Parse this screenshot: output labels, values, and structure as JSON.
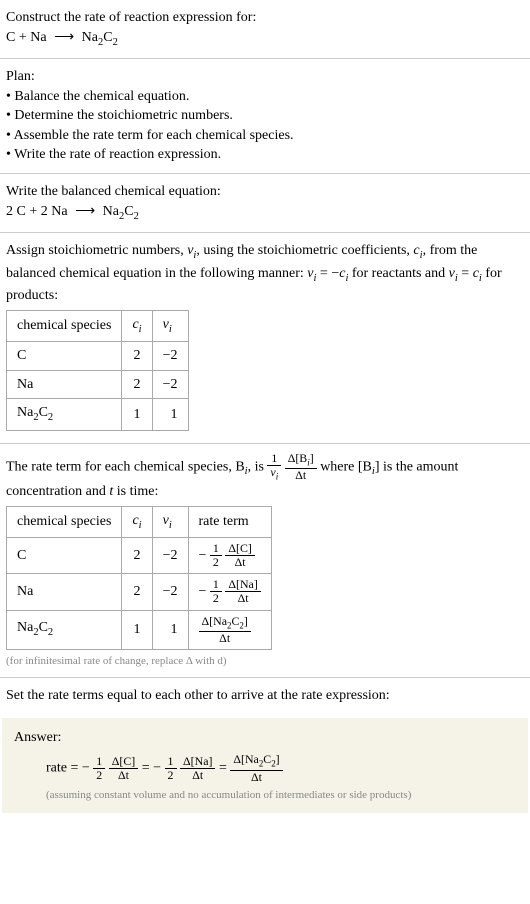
{
  "header": {
    "prompt": "Construct the rate of reaction expression for:",
    "equation_lhs_1": "C",
    "equation_plus": " + ",
    "equation_lhs_2": "Na",
    "equation_arrow": "⟶",
    "equation_rhs": "Na",
    "equation_rhs_sub1": "2",
    "equation_rhs_2": "C",
    "equation_rhs_sub2": "2"
  },
  "plan": {
    "title": "Plan:",
    "items": [
      "Balance the chemical equation.",
      "Determine the stoichiometric numbers.",
      "Assemble the rate term for each chemical species.",
      "Write the rate of reaction expression."
    ]
  },
  "balanced": {
    "title": "Write the balanced chemical equation:",
    "coef1": "2 ",
    "sp1": "C",
    "plus": " + ",
    "coef2": "2 ",
    "sp2": "Na",
    "arrow": "⟶",
    "sp3a": "Na",
    "sp3sub1": "2",
    "sp3b": "C",
    "sp3sub2": "2"
  },
  "stoich": {
    "intro_1": "Assign stoichiometric numbers, ",
    "nu": "ν",
    "sub_i": "i",
    "intro_2": ", using the stoichiometric coefficients, ",
    "c": "c",
    "intro_3": ", from the balanced chemical equation in the following manner: ",
    "eq1_lhs": "ν",
    "eq1_eq": " = −",
    "eq1_rhs": "c",
    "intro_4": " for reactants and ",
    "eq2_eq": " = ",
    "intro_5": " for products:",
    "table": {
      "headers": [
        "chemical species",
        "c_i",
        "ν_i"
      ],
      "header_c": "c",
      "header_nu": "ν",
      "header_sub": "i",
      "rows": [
        {
          "species_a": "C",
          "species_sub1": "",
          "species_b": "",
          "species_sub2": "",
          "c": "2",
          "nu": "−2"
        },
        {
          "species_a": "Na",
          "species_sub1": "",
          "species_b": "",
          "species_sub2": "",
          "c": "2",
          "nu": "−2"
        },
        {
          "species_a": "Na",
          "species_sub1": "2",
          "species_b": "C",
          "species_sub2": "2",
          "c": "1",
          "nu": "1"
        }
      ]
    }
  },
  "rateterm": {
    "intro_1": "The rate term for each chemical species, B",
    "intro_2": ", is ",
    "frac1_num": "1",
    "frac1_den_sym": "ν",
    "frac1_den_sub": "i",
    "frac2_num_delta": "Δ[B",
    "frac2_num_sub": "i",
    "frac2_num_close": "]",
    "frac2_den": "Δt",
    "intro_3": " where [B",
    "intro_4": "] is the amount concentration and ",
    "t": "t",
    "intro_5": " is time:",
    "table": {
      "header_species": "chemical species",
      "header_c": "c",
      "header_nu": "ν",
      "header_sub": "i",
      "header_rate": "rate term",
      "rows": [
        {
          "species_a": "C",
          "species_sub1": "",
          "species_b": "",
          "species_sub2": "",
          "c": "2",
          "nu": "−2",
          "prefix": "−",
          "coef_num": "1",
          "coef_den": "2",
          "conc_num": "Δ[C]",
          "conc_den": "Δt"
        },
        {
          "species_a": "Na",
          "species_sub1": "",
          "species_b": "",
          "species_sub2": "",
          "c": "2",
          "nu": "−2",
          "prefix": "−",
          "coef_num": "1",
          "coef_den": "2",
          "conc_num": "Δ[Na]",
          "conc_den": "Δt"
        },
        {
          "species_a": "Na",
          "species_sub1": "2",
          "species_b": "C",
          "species_sub2": "2",
          "c": "1",
          "nu": "1",
          "prefix": "",
          "coef_num": "",
          "coef_den": "",
          "conc_num_a": "Δ[Na",
          "conc_num_sub1": "2",
          "conc_num_b": "C",
          "conc_num_sub2": "2",
          "conc_num_close": "]",
          "conc_den": "Δt"
        }
      ]
    },
    "footnote": "(for infinitesimal rate of change, replace Δ with d)"
  },
  "final": {
    "title": "Set the rate terms equal to each other to arrive at the rate expression:"
  },
  "answer": {
    "label": "Answer:",
    "rate_label": "rate = ",
    "neg": "−",
    "half_num": "1",
    "half_den": "2",
    "term1_num": "Δ[C]",
    "term1_den": "Δt",
    "eq": " = ",
    "term2_num": "Δ[Na]",
    "term2_den": "Δt",
    "term3_num_a": "Δ[Na",
    "term3_sub1": "2",
    "term3_num_b": "C",
    "term3_sub2": "2",
    "term3_close": "]",
    "term3_den": "Δt",
    "note": "(assuming constant volume and no accumulation of intermediates or side products)"
  }
}
